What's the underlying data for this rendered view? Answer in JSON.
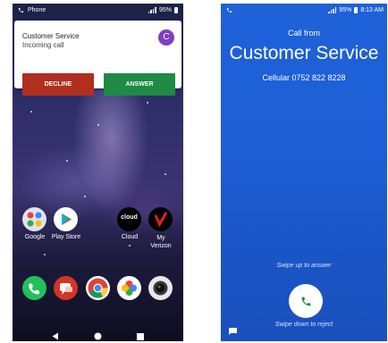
{
  "left_screen": {
    "status_bar": {
      "app_name": "Phone",
      "battery": "95%"
    },
    "notification": {
      "caller": "Customer Service",
      "status": "Incoming call",
      "avatar_letter": "C",
      "decline_label": "DECLINE",
      "answer_label": "ANSWER"
    },
    "home_apps": [
      {
        "label": "Google",
        "icon": "google-folder-icon"
      },
      {
        "label": "Play Store",
        "icon": "play-store-icon"
      },
      {
        "label": "Cloud",
        "icon": "cloud-icon",
        "badge_text": "cloud"
      },
      {
        "label": "My\nVerizon",
        "icon": "verizon-icon"
      }
    ],
    "dock": [
      {
        "icon": "phone-icon"
      },
      {
        "icon": "messages-icon"
      },
      {
        "icon": "chrome-icon"
      },
      {
        "icon": "photos-icon"
      },
      {
        "icon": "camera-icon"
      }
    ],
    "nav": [
      "back-icon",
      "home-icon",
      "recents-icon"
    ]
  },
  "right_screen": {
    "status_bar": {
      "battery": "95%",
      "time": "8:13 AM"
    },
    "call_from": "Call from",
    "caller": "Customer Service",
    "number": "Cellular 0752 822 8228",
    "swipe_up_hint": "Swipe up to answer",
    "swipe_down_hint": "Swipe down to reject"
  },
  "colors": {
    "decline": "#b0301e",
    "answer": "#1e8a45",
    "call_bg": "#1f5fd6",
    "avatar": "#7e3fbf"
  }
}
